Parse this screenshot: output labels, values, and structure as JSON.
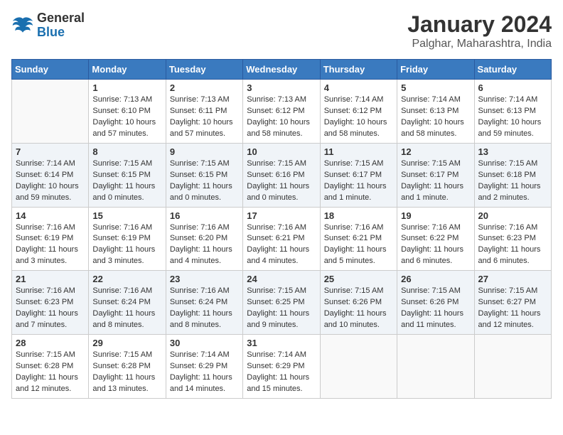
{
  "header": {
    "logo_line1": "General",
    "logo_line2": "Blue",
    "main_title": "January 2024",
    "subtitle": "Palghar, Maharashtra, India"
  },
  "days_of_week": [
    "Sunday",
    "Monday",
    "Tuesday",
    "Wednesday",
    "Thursday",
    "Friday",
    "Saturday"
  ],
  "weeks": [
    [
      {
        "day": "",
        "info": ""
      },
      {
        "day": "1",
        "info": "Sunrise: 7:13 AM\nSunset: 6:10 PM\nDaylight: 10 hours\nand 57 minutes."
      },
      {
        "day": "2",
        "info": "Sunrise: 7:13 AM\nSunset: 6:11 PM\nDaylight: 10 hours\nand 57 minutes."
      },
      {
        "day": "3",
        "info": "Sunrise: 7:13 AM\nSunset: 6:12 PM\nDaylight: 10 hours\nand 58 minutes."
      },
      {
        "day": "4",
        "info": "Sunrise: 7:14 AM\nSunset: 6:12 PM\nDaylight: 10 hours\nand 58 minutes."
      },
      {
        "day": "5",
        "info": "Sunrise: 7:14 AM\nSunset: 6:13 PM\nDaylight: 10 hours\nand 58 minutes."
      },
      {
        "day": "6",
        "info": "Sunrise: 7:14 AM\nSunset: 6:13 PM\nDaylight: 10 hours\nand 59 minutes."
      }
    ],
    [
      {
        "day": "7",
        "info": "Sunrise: 7:14 AM\nSunset: 6:14 PM\nDaylight: 10 hours\nand 59 minutes."
      },
      {
        "day": "8",
        "info": "Sunrise: 7:15 AM\nSunset: 6:15 PM\nDaylight: 11 hours\nand 0 minutes."
      },
      {
        "day": "9",
        "info": "Sunrise: 7:15 AM\nSunset: 6:15 PM\nDaylight: 11 hours\nand 0 minutes."
      },
      {
        "day": "10",
        "info": "Sunrise: 7:15 AM\nSunset: 6:16 PM\nDaylight: 11 hours\nand 0 minutes."
      },
      {
        "day": "11",
        "info": "Sunrise: 7:15 AM\nSunset: 6:17 PM\nDaylight: 11 hours\nand 1 minute."
      },
      {
        "day": "12",
        "info": "Sunrise: 7:15 AM\nSunset: 6:17 PM\nDaylight: 11 hours\nand 1 minute."
      },
      {
        "day": "13",
        "info": "Sunrise: 7:15 AM\nSunset: 6:18 PM\nDaylight: 11 hours\nand 2 minutes."
      }
    ],
    [
      {
        "day": "14",
        "info": "Sunrise: 7:16 AM\nSunset: 6:19 PM\nDaylight: 11 hours\nand 3 minutes."
      },
      {
        "day": "15",
        "info": "Sunrise: 7:16 AM\nSunset: 6:19 PM\nDaylight: 11 hours\nand 3 minutes."
      },
      {
        "day": "16",
        "info": "Sunrise: 7:16 AM\nSunset: 6:20 PM\nDaylight: 11 hours\nand 4 minutes."
      },
      {
        "day": "17",
        "info": "Sunrise: 7:16 AM\nSunset: 6:21 PM\nDaylight: 11 hours\nand 4 minutes."
      },
      {
        "day": "18",
        "info": "Sunrise: 7:16 AM\nSunset: 6:21 PM\nDaylight: 11 hours\nand 5 minutes."
      },
      {
        "day": "19",
        "info": "Sunrise: 7:16 AM\nSunset: 6:22 PM\nDaylight: 11 hours\nand 6 minutes."
      },
      {
        "day": "20",
        "info": "Sunrise: 7:16 AM\nSunset: 6:23 PM\nDaylight: 11 hours\nand 6 minutes."
      }
    ],
    [
      {
        "day": "21",
        "info": "Sunrise: 7:16 AM\nSunset: 6:23 PM\nDaylight: 11 hours\nand 7 minutes."
      },
      {
        "day": "22",
        "info": "Sunrise: 7:16 AM\nSunset: 6:24 PM\nDaylight: 11 hours\nand 8 minutes."
      },
      {
        "day": "23",
        "info": "Sunrise: 7:16 AM\nSunset: 6:24 PM\nDaylight: 11 hours\nand 8 minutes."
      },
      {
        "day": "24",
        "info": "Sunrise: 7:15 AM\nSunset: 6:25 PM\nDaylight: 11 hours\nand 9 minutes."
      },
      {
        "day": "25",
        "info": "Sunrise: 7:15 AM\nSunset: 6:26 PM\nDaylight: 11 hours\nand 10 minutes."
      },
      {
        "day": "26",
        "info": "Sunrise: 7:15 AM\nSunset: 6:26 PM\nDaylight: 11 hours\nand 11 minutes."
      },
      {
        "day": "27",
        "info": "Sunrise: 7:15 AM\nSunset: 6:27 PM\nDaylight: 11 hours\nand 12 minutes."
      }
    ],
    [
      {
        "day": "28",
        "info": "Sunrise: 7:15 AM\nSunset: 6:28 PM\nDaylight: 11 hours\nand 12 minutes."
      },
      {
        "day": "29",
        "info": "Sunrise: 7:15 AM\nSunset: 6:28 PM\nDaylight: 11 hours\nand 13 minutes."
      },
      {
        "day": "30",
        "info": "Sunrise: 7:14 AM\nSunset: 6:29 PM\nDaylight: 11 hours\nand 14 minutes."
      },
      {
        "day": "31",
        "info": "Sunrise: 7:14 AM\nSunset: 6:29 PM\nDaylight: 11 hours\nand 15 minutes."
      },
      {
        "day": "",
        "info": ""
      },
      {
        "day": "",
        "info": ""
      },
      {
        "day": "",
        "info": ""
      }
    ]
  ]
}
